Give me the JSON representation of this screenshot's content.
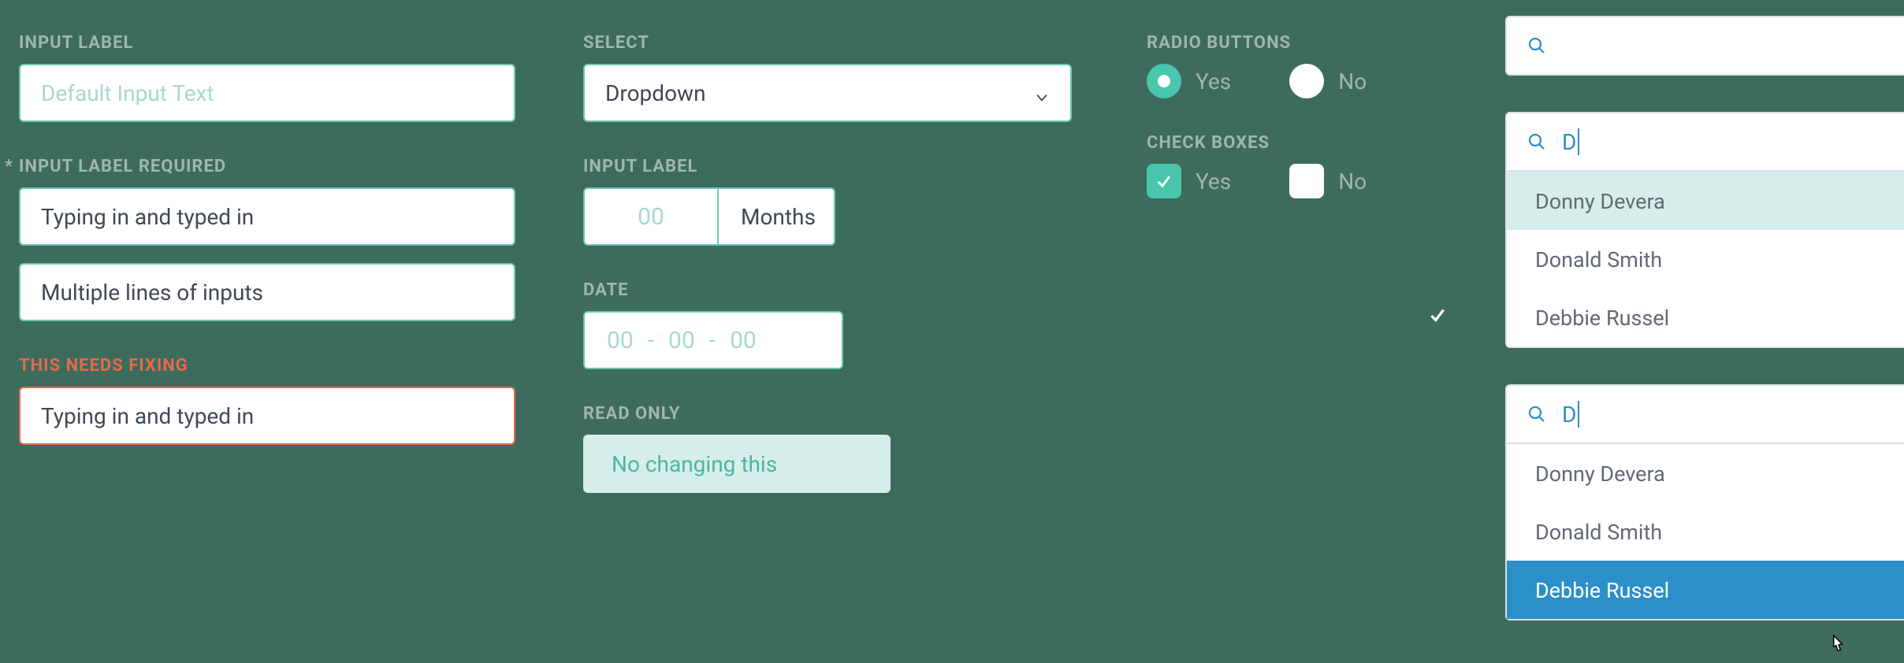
{
  "col1": {
    "input1": {
      "label": "INPUT LABEL",
      "placeholder": "Default Input Text"
    },
    "input2": {
      "label": "INPUT LABEL REQUIRED",
      "line1": "Typing in and typed in",
      "line2": "Multiple lines of inputs"
    },
    "input3": {
      "label": "THIS NEEDS FIXING",
      "value": "Typing in and typed in"
    }
  },
  "col2": {
    "select": {
      "label": "SELECT",
      "value": "Dropdown"
    },
    "months": {
      "label": "INPUT LABEL",
      "placeholder": "00",
      "suffix": "Months"
    },
    "date": {
      "label": "DATE",
      "d": "00",
      "m": "00",
      "y": "00"
    },
    "readonly": {
      "label": "READ ONLY",
      "value": "No changing this"
    }
  },
  "col3": {
    "radios": {
      "label": "RADIO BUTTONS",
      "yes": "Yes",
      "no": "No"
    },
    "checks": {
      "label": "CHECK BOXES",
      "yes": "Yes",
      "no": "No"
    }
  },
  "search": {
    "box1": {
      "query": ""
    },
    "box2": {
      "query": "D",
      "options": {
        "o1": "Donny Devera",
        "o2": "Donald Smith",
        "o3": "Debbie Russel"
      }
    },
    "box3": {
      "query": "D",
      "options": {
        "o1": "Donny Devera",
        "o2": "Donald Smith",
        "o3": "Debbie Russel"
      }
    }
  }
}
